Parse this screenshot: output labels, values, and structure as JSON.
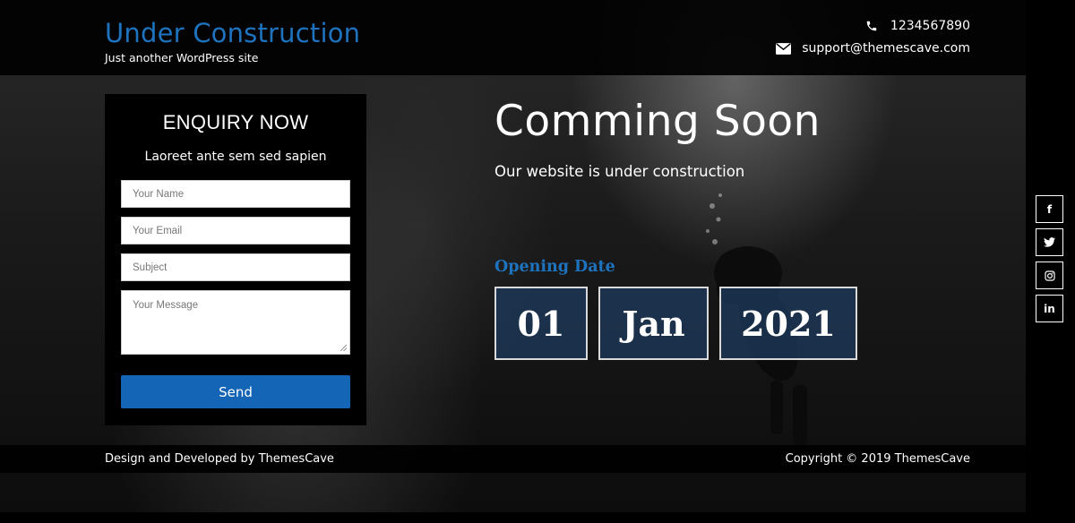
{
  "header": {
    "site_title": "Under Construction",
    "tagline": "Just another WordPress site",
    "phone": "1234567890",
    "email": "support@themescave.com"
  },
  "enquiry": {
    "title": "ENQUIRY NOW",
    "subtitle": "Laoreet ante sem sed sapien",
    "name_placeholder": "Your Name",
    "email_placeholder": "Your Email",
    "subject_placeholder": "Subject",
    "message_placeholder": "Your Message",
    "send_label": "Send"
  },
  "hero": {
    "title": "Comming Soon",
    "subtitle": "Our website is under construction",
    "opening_label": "Opening Date",
    "day": "01",
    "month": "Jan",
    "year": "2021"
  },
  "social": {
    "facebook": "f",
    "linkedin": "in"
  },
  "footer": {
    "left": "Design and Developed by ThemesCave",
    "right": "Copyright © 2019 ThemesCave"
  },
  "colors": {
    "accent": "#1e73be",
    "button": "#1565b7",
    "date_box": "#1e3c5f"
  },
  "icons": [
    "phone-icon",
    "envelope-icon",
    "facebook-icon",
    "twitter-icon",
    "instagram-icon",
    "linkedin-icon"
  ]
}
